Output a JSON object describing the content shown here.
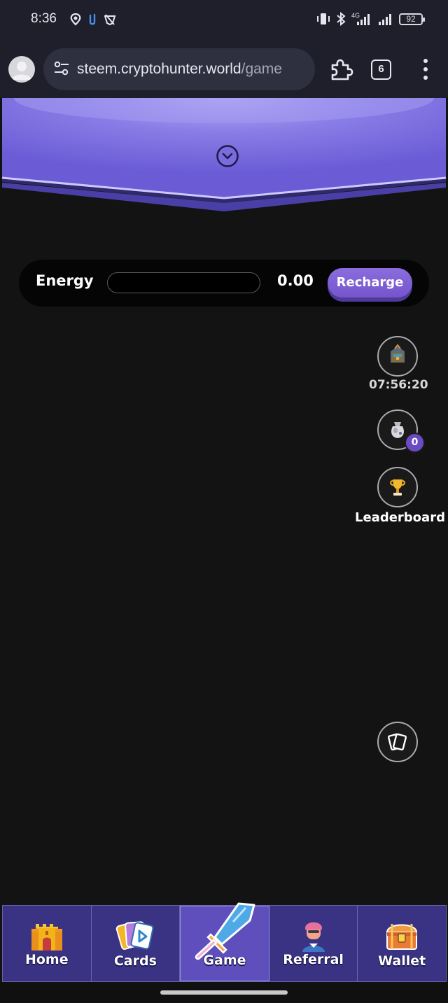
{
  "status_bar": {
    "time": "8:36",
    "battery": "92",
    "network_label": "4G",
    "left_icons": [
      "location-pin-icon",
      "paperclip-icon",
      "shield-off-icon"
    ],
    "right_icons": [
      "vibrate-icon",
      "bluetooth-icon",
      "signal-4g-icon",
      "signal-icon",
      "battery-icon"
    ]
  },
  "browser": {
    "url_host": "steem.cryptohunter.world",
    "url_path": "/game",
    "tab_count": "6",
    "icons": [
      "account-avatar-icon",
      "site-settings-icon",
      "extensions-puzzle-icon",
      "tabs-icon",
      "more-vert-icon"
    ]
  },
  "banner": {
    "accent": "#7d6fe0",
    "icon": "chevron-down-circle-icon"
  },
  "energy": {
    "label": "Energy",
    "value": "0.00",
    "fill_fraction": 0,
    "recharge_label": "Recharge",
    "accent": "#7b5fd3"
  },
  "side_buttons": {
    "chest": {
      "icon": "treasure-chest-icon",
      "timer": "07:56:20"
    },
    "potion": {
      "icon": "potion-bag-icon",
      "badge": "0"
    },
    "leaderboard": {
      "icon": "trophy-icon",
      "label": "Leaderboard"
    },
    "cards": {
      "icon": "card-stack-icon"
    }
  },
  "nav": {
    "items": [
      {
        "label": "Home",
        "icon": "castle-icon"
      },
      {
        "label": "Cards",
        "icon": "cards-icon"
      },
      {
        "label": "Game",
        "icon": "sword-icon",
        "active": true
      },
      {
        "label": "Referral",
        "icon": "person-icon"
      },
      {
        "label": "Wallet",
        "icon": "treasure-chest-icon"
      }
    ],
    "bg": "#3a3384",
    "active_bg": "#5f4fbd"
  }
}
